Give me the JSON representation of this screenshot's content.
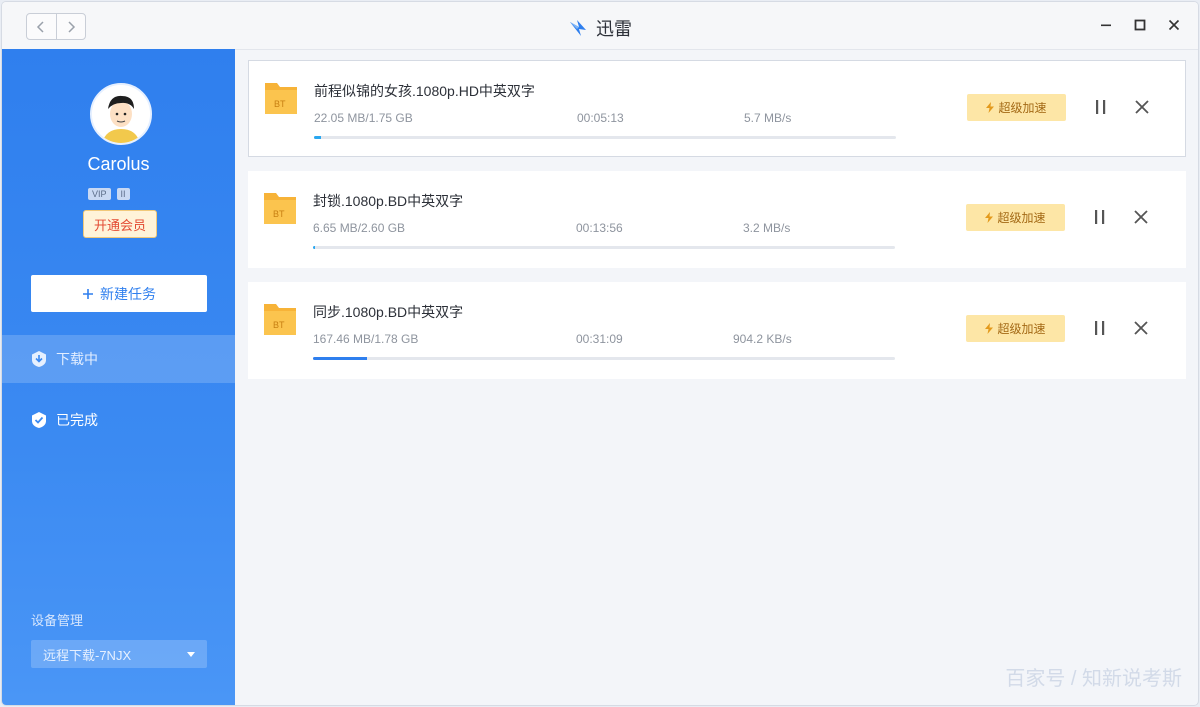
{
  "window": {
    "title": "迅雷"
  },
  "sidebar": {
    "username": "Carolus",
    "vip_badges": [
      "VIP",
      "II"
    ],
    "member_button": "开通会员",
    "new_task_button": "新建任务",
    "nav": [
      {
        "label": "下载中",
        "icon": "download-icon",
        "active": true
      },
      {
        "label": "已完成",
        "icon": "check-shield-icon",
        "active": false
      }
    ],
    "device_label": "设备管理",
    "device_select": "远程下载-7NJX"
  },
  "tasks": [
    {
      "name": "前程似锦的女孩.1080p.HD中英双字",
      "size": "22.05 MB/1.75 GB",
      "time": "00:05:13",
      "speed": "5.7 MB/s",
      "progress": 0.012,
      "boost_label": "超级加速",
      "selected": true
    },
    {
      "name": "封锁.1080p.BD中英双字",
      "size": "6.65 MB/2.60 GB",
      "time": "00:13:56",
      "speed": "3.2 MB/s",
      "progress": 0.003,
      "boost_label": "超级加速",
      "selected": false
    },
    {
      "name": "同步.1080p.BD中英双字",
      "size": "167.46 MB/1.78 GB",
      "time": "00:31:09",
      "speed": "904.2 KB/s",
      "progress": 0.092,
      "boost_label": "超级加速",
      "selected": false
    }
  ],
  "watermark": "百家号 / 知新说考斯",
  "colors": {
    "accent": "#2f7fee",
    "progress": "#2aa7f0",
    "boost_bg": "#fde6a6",
    "member_text": "#e34b33"
  }
}
